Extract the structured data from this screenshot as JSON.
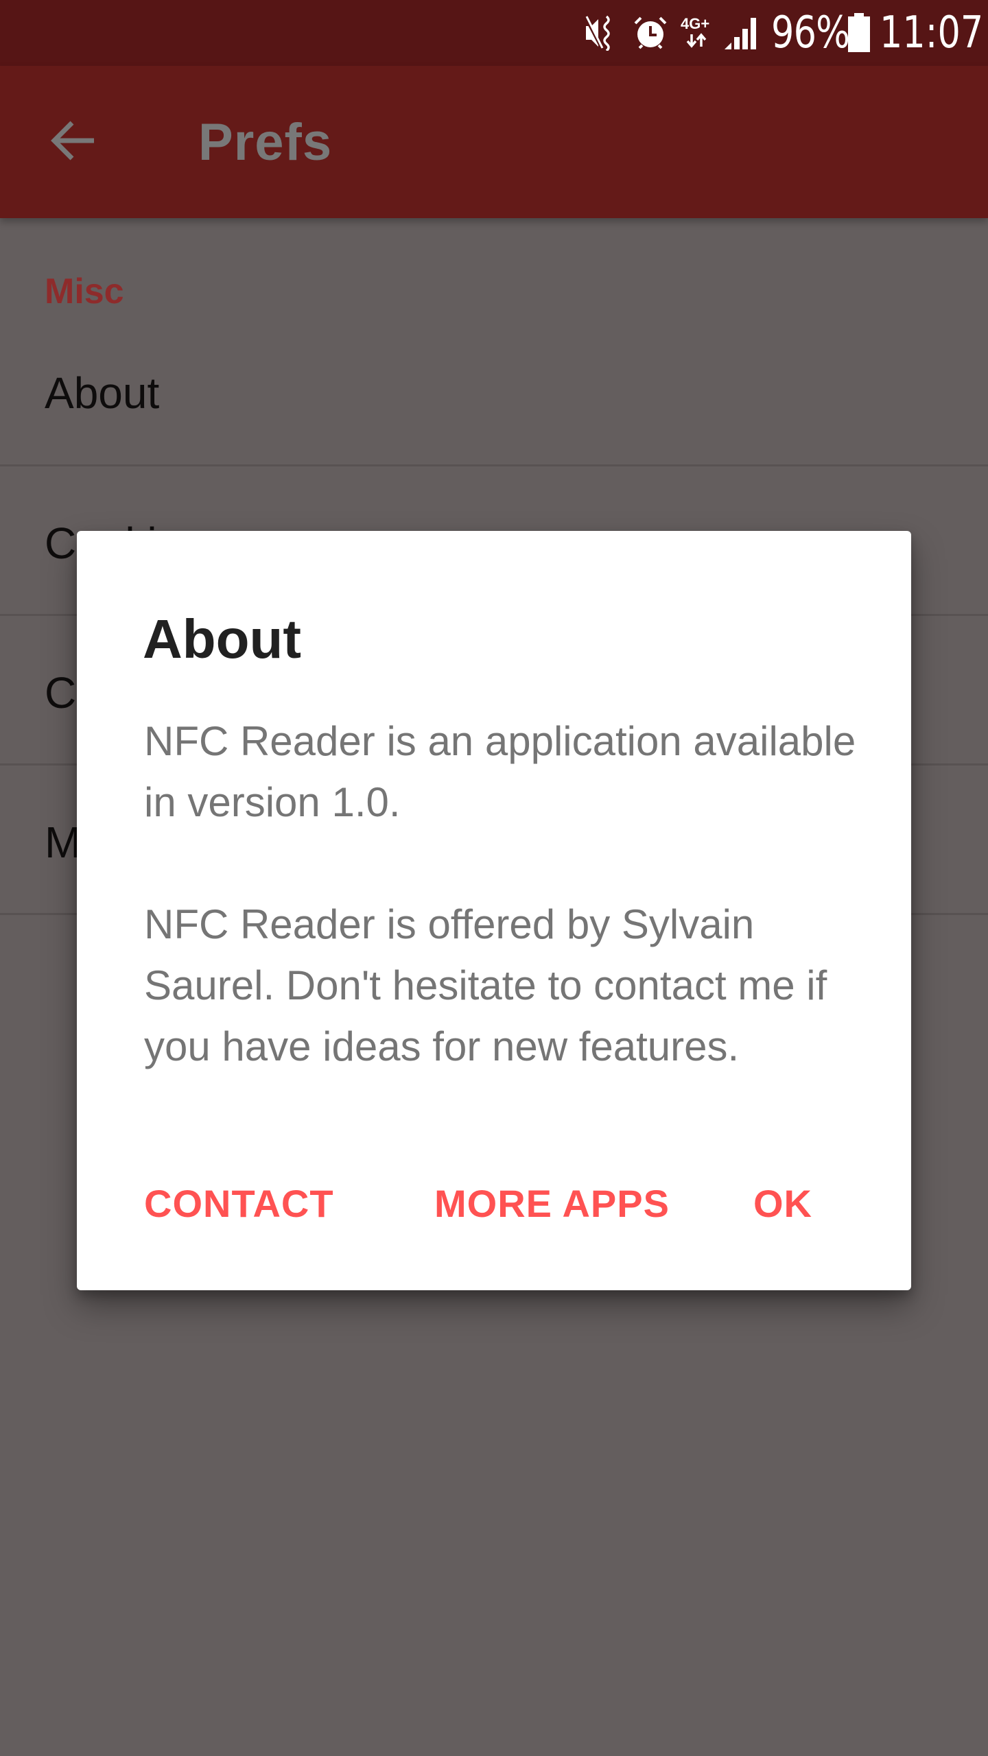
{
  "status_bar": {
    "icons": [
      "mute-vibrate-icon",
      "alarm-icon",
      "4g-plus-data-icon",
      "signal-strength-icon",
      "battery-icon"
    ],
    "network_label": "4G+",
    "battery_percent": "96%",
    "time": "11:07"
  },
  "toolbar": {
    "back_icon": "arrow-back-icon",
    "title": "Prefs"
  },
  "preferences": {
    "category": "Misc",
    "items": [
      {
        "title": "About"
      },
      {
        "title": "Cookies"
      },
      {
        "title": "Co"
      },
      {
        "title": "M"
      }
    ]
  },
  "dialog": {
    "title": "About",
    "paragraphs": [
      "NFC Reader is an application available in version 1.0.",
      "NFC Reader is offered by Sylvain Saurel. Don't hesitate to contact me if you have ideas for new features."
    ],
    "buttons": {
      "contact": "CONTACT",
      "more_apps": "MORE APPS",
      "ok": "OK"
    }
  },
  "colors": {
    "status_bar": "#561515",
    "toolbar": "#641A18",
    "accent": "#FF5252",
    "category": "#8E2B2B",
    "scrim_background": "#645E5E",
    "dialog_background": "#FFFFFF",
    "dialog_title": "#212121",
    "dialog_text": "#757575"
  }
}
